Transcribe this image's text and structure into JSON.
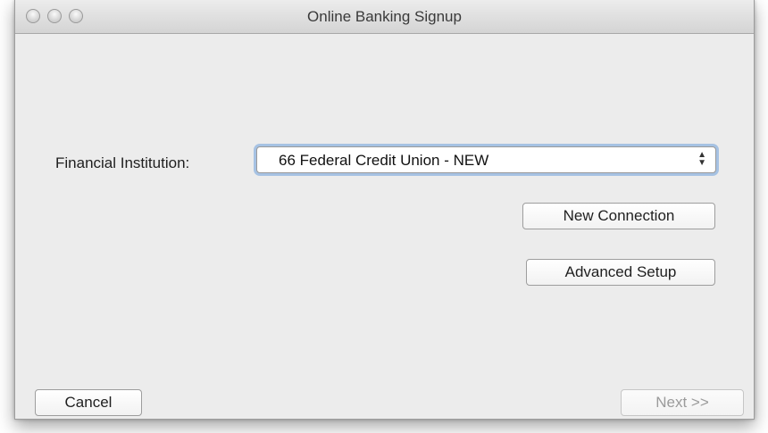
{
  "window": {
    "title": "Online Banking Signup"
  },
  "form": {
    "institution_label": "Financial Institution:",
    "institution_value": "66 Federal Credit Union - NEW",
    "select_arrows": "▲\n▼"
  },
  "actions": {
    "new_connection_label": "New Connection",
    "advanced_setup_label": "Advanced Setup",
    "cancel_label": "Cancel",
    "next_label": "Next >>",
    "next_enabled": false
  },
  "colors": {
    "window_bg": "#ececec",
    "focus_ring": "#6ea0dc",
    "disabled_text": "#9b9b9b"
  }
}
